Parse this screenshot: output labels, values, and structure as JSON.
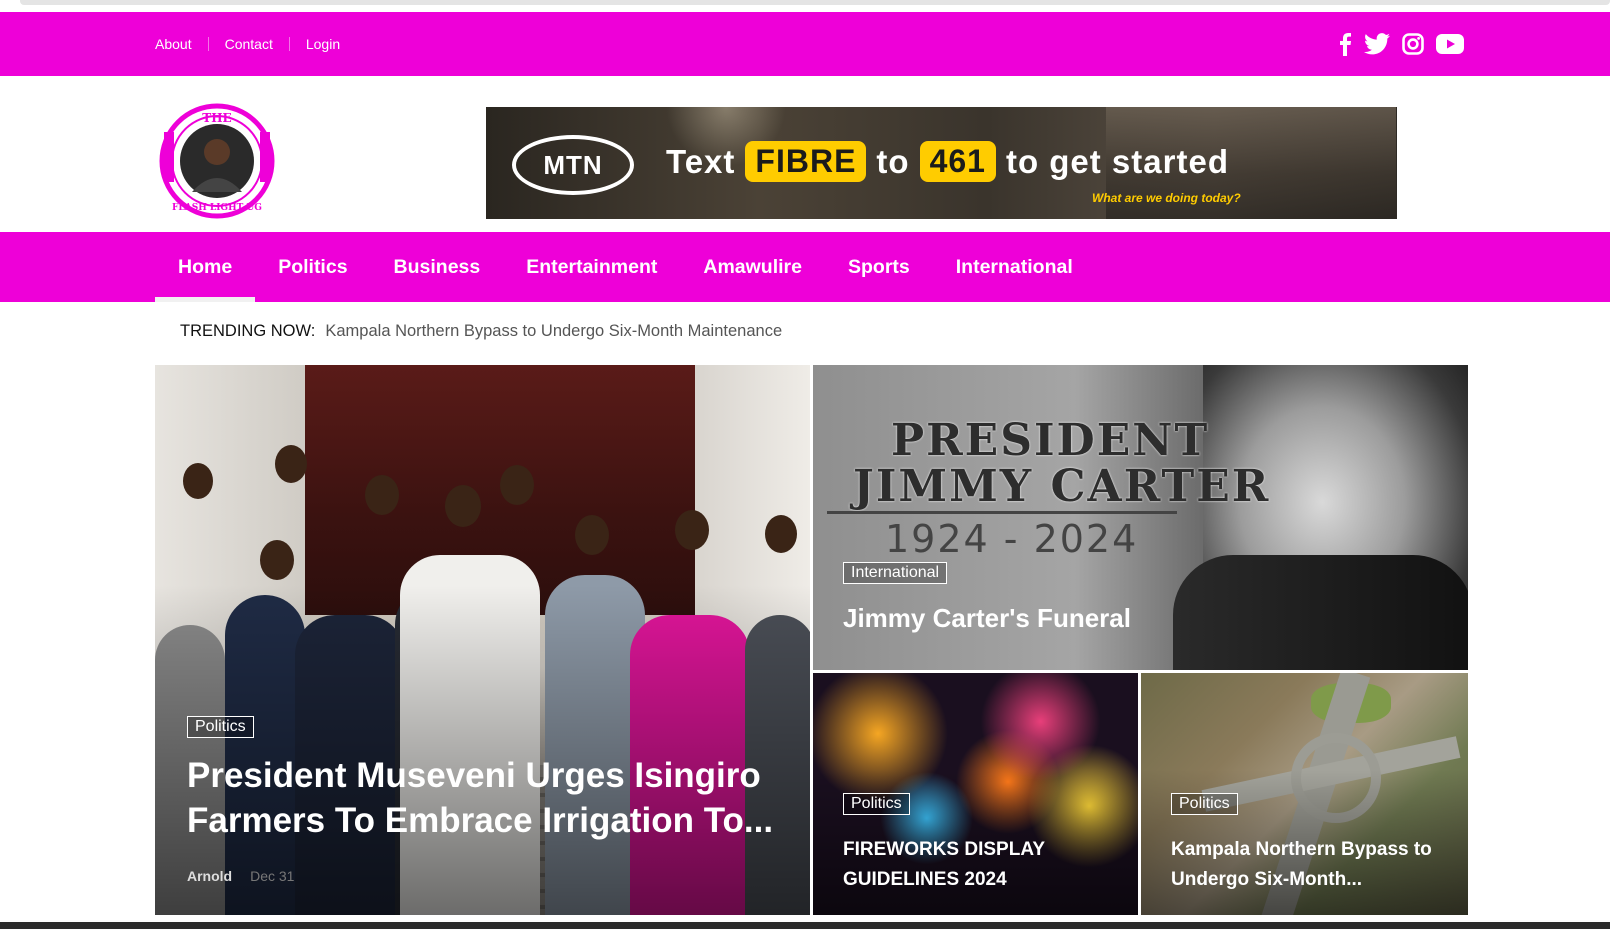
{
  "topbar": {
    "links": [
      "About",
      "Contact",
      "Login"
    ],
    "social_icons": [
      "facebook-icon",
      "twitter-icon",
      "instagram-icon",
      "youtube-icon"
    ]
  },
  "logo": {
    "text": "THE FLASH LIGHT UG"
  },
  "banner": {
    "brand": "MTN",
    "text_1": "Text",
    "pill_1": "FIBRE",
    "text_2": "to",
    "pill_2": "461",
    "text_3": "to get started",
    "sub": "What are we doing today?"
  },
  "nav": {
    "items": [
      "Home",
      "Politics",
      "Business",
      "Entertainment",
      "Amawulire",
      "Sports",
      "International"
    ],
    "active": "Home"
  },
  "trending": {
    "label": "TRENDING NOW:",
    "headline": "Kampala Northern Bypass to Undergo Six-Month Maintenance"
  },
  "featured": [
    {
      "category": "Politics",
      "title": "President Museveni Urges Isingiro Farmers To Embrace Irrigation To...",
      "author": "Arnold",
      "date": "Dec 31"
    },
    {
      "category": "International",
      "title": "Jimmy Carter's Funeral",
      "image_text": {
        "line1": "PRESIDENT",
        "line2": "JIMMY CARTER",
        "years": "1924 - 2024"
      }
    },
    {
      "category": "Politics",
      "title": "FIREWORKS DISPLAY GUIDELINES 2024"
    },
    {
      "category": "Politics",
      "title": "Kampala Northern Bypass to Undergo Six-Month..."
    }
  ],
  "colors": {
    "brand_magenta": "#ee00d8",
    "mtn_yellow": "#ffcc00"
  }
}
